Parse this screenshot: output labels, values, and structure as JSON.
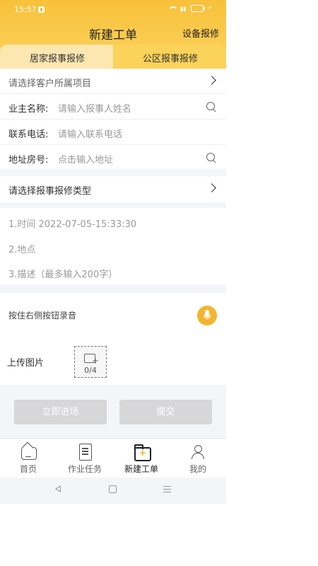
{
  "status_bar": {
    "time": "15:57"
  },
  "header": {
    "title": "新建工单",
    "action": "设备报修"
  },
  "tabs": [
    {
      "label": "居家报事报修",
      "active": true
    },
    {
      "label": "公区报事报修",
      "active": false
    }
  ],
  "form": {
    "project": {
      "placeholder": "请选择客户所属项目"
    },
    "owner": {
      "label": "业主名称:",
      "placeholder": "请输入报事人姓名"
    },
    "phone": {
      "label": "联系电话:",
      "placeholder": "请输入联系电话"
    },
    "address": {
      "label": "地址房号:",
      "placeholder": "点击输入地址"
    },
    "repair_type": {
      "label": "请选择报事报修类型"
    },
    "description_lines": [
      "1.时间 2022-07-05-15:33:30",
      "2.地点",
      "3.描述（最多输入200字）"
    ],
    "voice_hint": "按住右侧按钮录音",
    "upload": {
      "label": "上传图片",
      "counter": "0/4"
    }
  },
  "buttons": {
    "enter": "立即进场",
    "submit": "提交"
  },
  "bottom_nav": [
    {
      "label": "首页",
      "icon": "home-icon",
      "active": false
    },
    {
      "label": "作业任务",
      "icon": "task-clipboard-icon",
      "active": false
    },
    {
      "label": "新建工单",
      "icon": "new-order-folder-icon",
      "active": true
    },
    {
      "label": "我的",
      "icon": "user-icon",
      "active": false
    }
  ],
  "colors": {
    "accent": "#f3b52d",
    "header_top": "#f8c13a",
    "tab_active": "#fde7b1",
    "button_disabled": "#d7d7d9"
  }
}
